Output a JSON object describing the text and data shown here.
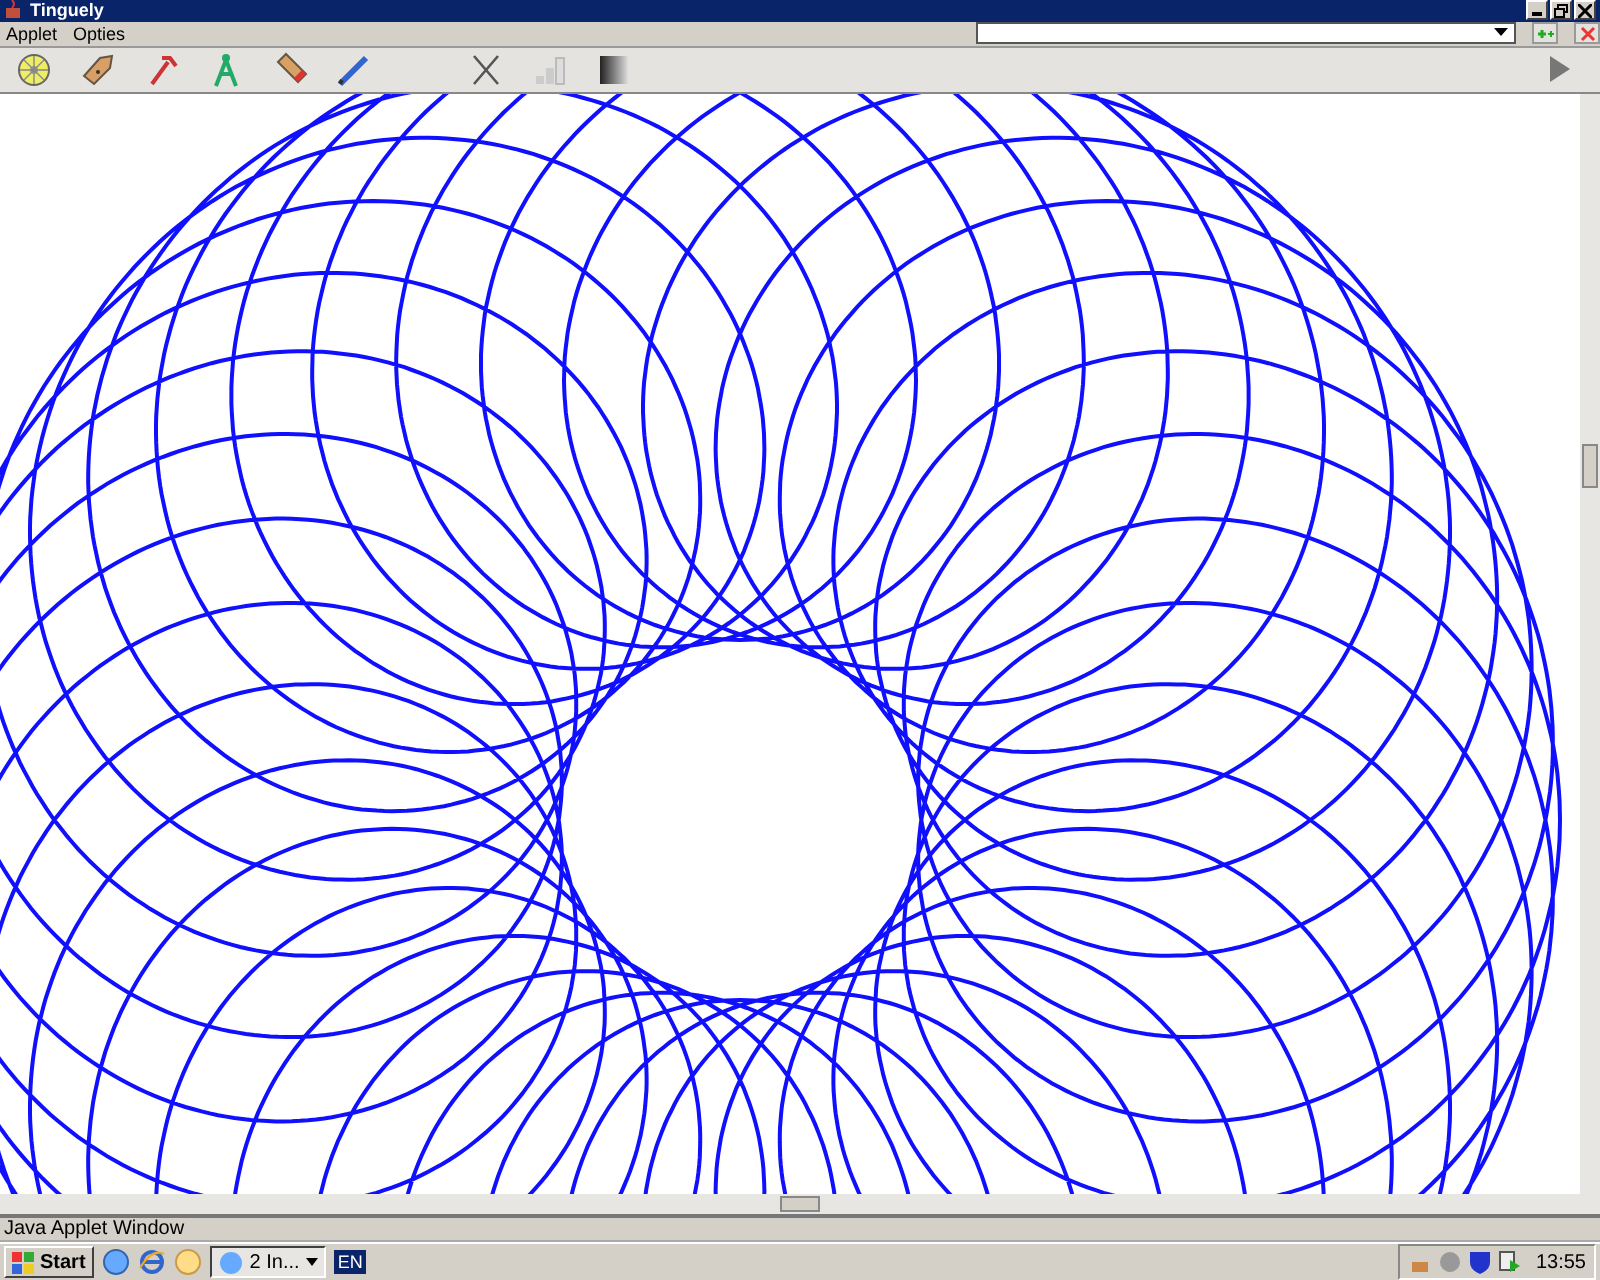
{
  "window": {
    "title": "Tinguely"
  },
  "menu": [
    "Applet",
    "Opties"
  ],
  "status_bar": "Java Applet Window",
  "taskbar": {
    "start": "Start",
    "task": "2 In...",
    "language": "EN",
    "clock": "13:55"
  }
}
